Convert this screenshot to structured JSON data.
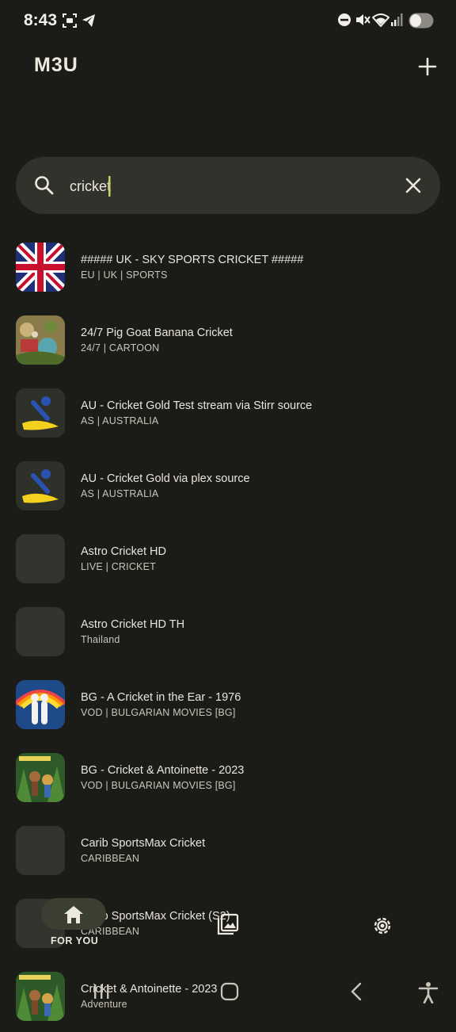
{
  "status": {
    "time": "8:43"
  },
  "app": {
    "title": "M3U"
  },
  "search": {
    "value": "cricket",
    "placeholder": ""
  },
  "channels": [
    {
      "title": "##### UK - SKY SPORTS CRICKET  #####",
      "subtitle": "EU | UK | SPORTS",
      "thumb": "uk-flag"
    },
    {
      "title": "24/7 Pig Goat Banana Cricket",
      "subtitle": "24/7 | CARTOON",
      "thumb": "cartoon-art"
    },
    {
      "title": "AU - Cricket Gold  Test stream via Stirr source",
      "subtitle": "AS | AUSTRALIA",
      "thumb": "cricket-gold-logo"
    },
    {
      "title": "AU - Cricket Gold  via plex source",
      "subtitle": "AS | AUSTRALIA",
      "thumb": "cricket-gold-logo"
    },
    {
      "title": "Astro Cricket HD",
      "subtitle": "LIVE | CRICKET",
      "thumb": "empty"
    },
    {
      "title": "Astro Cricket HD TH",
      "subtitle": "Thailand",
      "thumb": "empty"
    },
    {
      "title": "BG - A Cricket in the Ear - 1976",
      "subtitle": "VOD | BULGARIAN MOVIES [BG]",
      "thumb": "movie-poster-rainbow"
    },
    {
      "title": "BG - Cricket & Antoinette - 2023",
      "subtitle": "VOD | BULGARIAN MOVIES [BG]",
      "thumb": "movie-poster-jungle"
    },
    {
      "title": "Carib SportsMax Cricket",
      "subtitle": "CARIBBEAN",
      "thumb": "empty"
    },
    {
      "title": "Carib SportsMax Cricket (S2)",
      "subtitle": "CARIBBEAN",
      "thumb": "empty"
    },
    {
      "title": "Cricket & Antoinette - 2023",
      "subtitle": "Adventure",
      "thumb": "movie-poster-jungle"
    }
  ],
  "bottom_nav": {
    "home_label": "FOR YOU"
  },
  "icons": [
    "screenshot-icon",
    "telegram-icon",
    "dnd-icon",
    "mute-icon",
    "wifi-icon",
    "signal-icon",
    "battery-icon",
    "add-icon",
    "search-icon",
    "close-icon",
    "home-icon",
    "gallery-icon",
    "settings-icon",
    "recents-icon",
    "home-nav-icon",
    "back-icon",
    "accessibility-icon"
  ],
  "colors": {
    "background": "#1b1c18",
    "search_bg": "#30322b",
    "accent_caret": "#c9d36a",
    "nav_pill": "#3a3f31"
  }
}
